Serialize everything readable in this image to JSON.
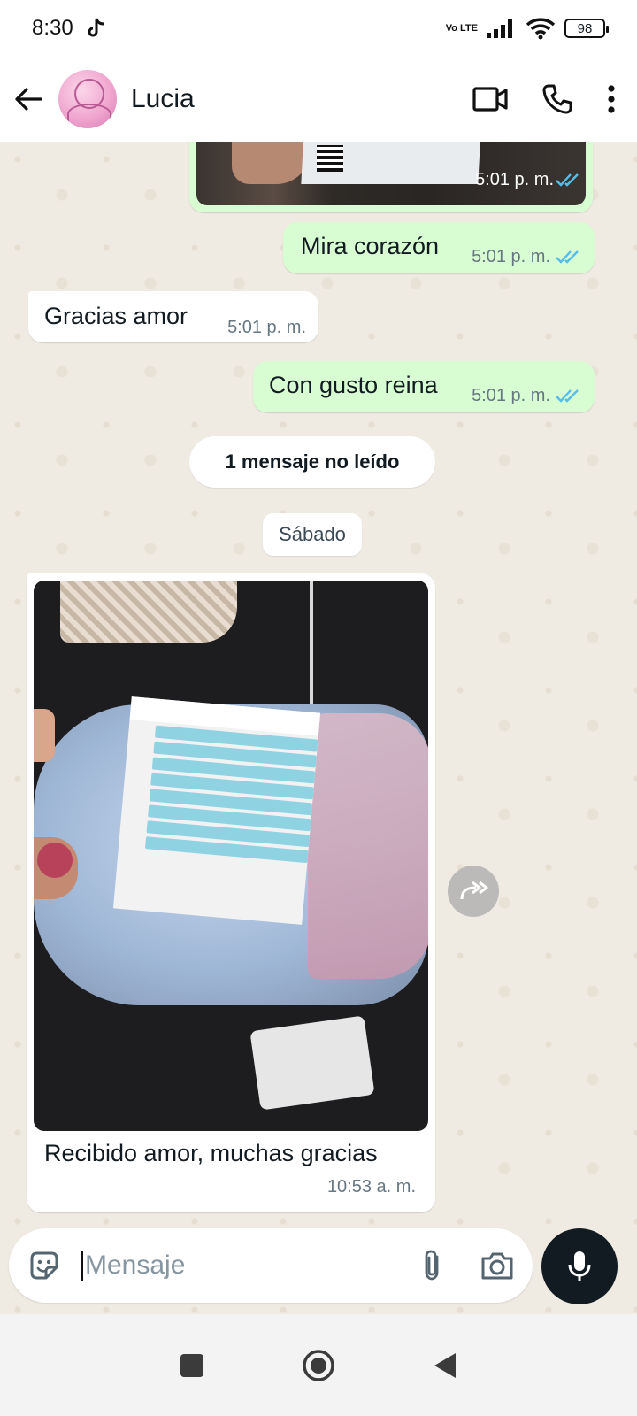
{
  "status_bar": {
    "time": "8:30",
    "network": "Vo LTE",
    "battery": "98"
  },
  "header": {
    "contact_name": "Lucia"
  },
  "messages": [
    {
      "direction": "out",
      "type": "image",
      "time": "5:01 p. m."
    },
    {
      "direction": "out",
      "type": "text",
      "text": "Mira corazón",
      "time": "5:01 p. m."
    },
    {
      "direction": "in",
      "type": "text",
      "text": "Gracias amor",
      "time": "5:01 p. m."
    },
    {
      "direction": "out",
      "type": "text",
      "text": "Con gusto reina",
      "time": "5:01 p. m."
    }
  ],
  "unread_banner": "1 mensaje no leído",
  "date_separator": "Sábado",
  "image_message": {
    "direction": "in",
    "caption": "Recibido amor, muchas gracias",
    "time": "10:53 a. m."
  },
  "composer": {
    "placeholder": "Mensaje"
  },
  "colors": {
    "outgoing_bubble": "#d9fdd3",
    "incoming_bubble": "#ffffff",
    "chat_background": "#efeae2",
    "read_ticks": "#53bdeb"
  }
}
